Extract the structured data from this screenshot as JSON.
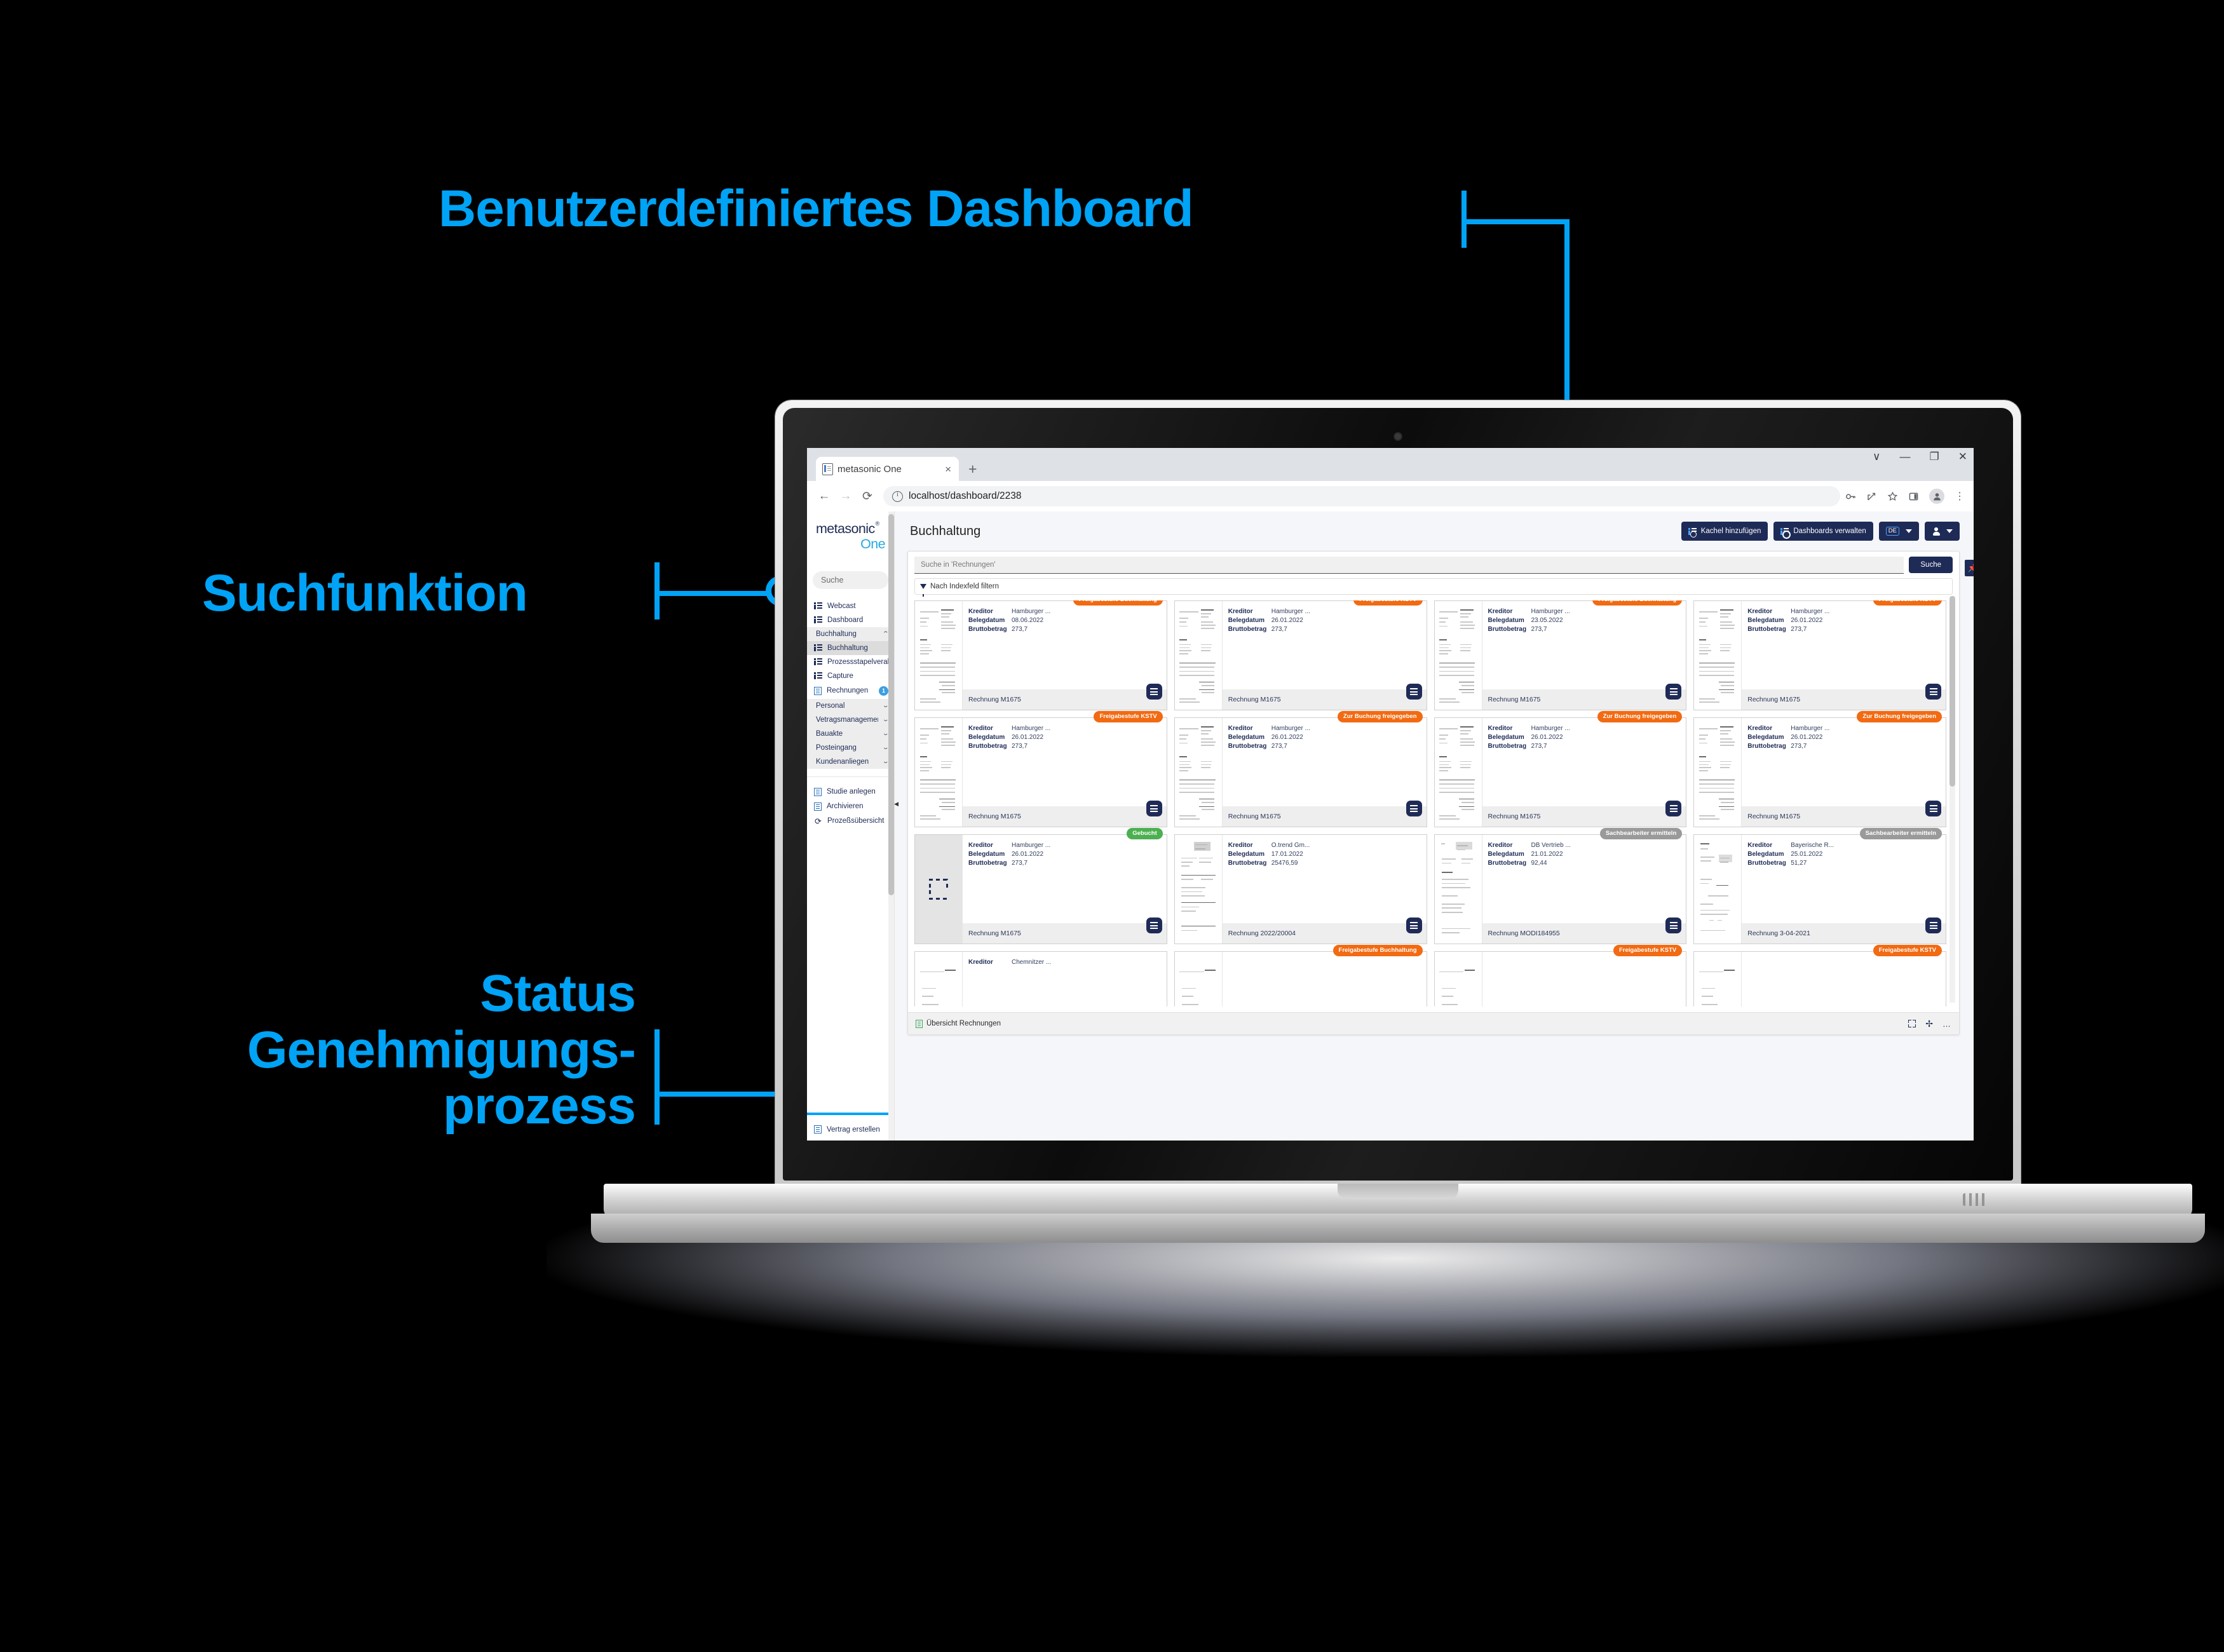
{
  "annotations": [
    {
      "id": "dashboard",
      "text": "Benutzerdefiniertes Dashboard"
    },
    {
      "id": "suche",
      "text": "Suchfunktion"
    },
    {
      "id": "status",
      "text": "Status Genehmigungs-prozess"
    }
  ],
  "accent_color": "#00A3F5",
  "browser": {
    "tab_title": "metasonic One",
    "tab_close": "×",
    "new_tab": "+",
    "back": "←",
    "forward": "→",
    "reload": "⟳",
    "url": "localhost/dashboard/2238",
    "window_controls": [
      "∨",
      "—",
      "❐",
      "✕"
    ],
    "actions": [
      "key-icon",
      "share-icon",
      "bookmark-star-icon",
      "sidepanel-icon",
      "profile-icon",
      "menu-kebab-icon"
    ],
    "kebab": "⋮"
  },
  "sidebar": {
    "logo_line1": "metasonic",
    "logo_reg": "®",
    "logo_line2": "One",
    "search_placeholder": "Suche",
    "items": [
      {
        "label": "Webcast",
        "icon": "list-icon",
        "type": "link"
      },
      {
        "label": "Dashboard",
        "icon": "list-icon",
        "type": "link"
      },
      {
        "label": "Buchhaltung",
        "icon": "none",
        "type": "group",
        "expanded": true,
        "chevron": "⌃"
      },
      {
        "label": "Buchhaltung",
        "icon": "list-icon",
        "type": "link",
        "active": true
      },
      {
        "label": "Prozessstapelverabeitung",
        "icon": "list-icon",
        "type": "link"
      },
      {
        "label": "Capture",
        "icon": "list-icon",
        "type": "link"
      },
      {
        "label": "Rechnungen",
        "icon": "invoice-icon",
        "type": "link",
        "badge": "1"
      },
      {
        "label": "Personal",
        "icon": "none",
        "type": "group",
        "chevron": "⌄"
      },
      {
        "label": "Vetragsmanagement",
        "icon": "none",
        "type": "group",
        "chevron": "⌄"
      },
      {
        "label": "Bauakte",
        "icon": "none",
        "type": "group",
        "chevron": "⌄"
      },
      {
        "label": "Posteingang",
        "icon": "none",
        "type": "group",
        "chevron": "⌄"
      },
      {
        "label": "Kundenanliegen",
        "icon": "none",
        "type": "group",
        "chevron": "⌄"
      }
    ],
    "actions": [
      {
        "label": "Studie anlegen",
        "icon": "doc-icon"
      },
      {
        "label": "Archivieren",
        "icon": "doc-icon"
      },
      {
        "label": "Prozeßsübersicht",
        "icon": "sync-icon"
      }
    ],
    "footer": [
      {
        "label": "Vertrag erstellen",
        "icon": "doc-icon"
      }
    ]
  },
  "header": {
    "title": "Buchhaltung",
    "buttons": [
      {
        "label": "Kachel hinzufügen",
        "icon": "tile-add-icon"
      },
      {
        "label": "Dashboards verwalten",
        "icon": "tile-settings-icon"
      }
    ],
    "language": "DE",
    "caret": "▾"
  },
  "panel": {
    "search_placeholder": "Suche in 'Rechnungen'",
    "search_button": "Suche",
    "filter_label": "Nach Indexfeld filtern",
    "footer_label": "Übersicht Rechnungen",
    "footer_icons": [
      "fullscreen-icon",
      "move-icon",
      "more-icon"
    ],
    "more": "…",
    "field_labels": {
      "kreditor": "Kreditor",
      "belegdatum": "Belegdatum",
      "bruttobetrag": "Bruttobetrag"
    },
    "pin_icon": "pin-icon"
  },
  "cards": [
    {
      "status": "Freigabestufe Buchhaltung",
      "status_color": "orange",
      "kreditor": "Hamburger ...",
      "belegdatum": "08.06.2022",
      "bruttobetrag": "273,7",
      "title": "Rechnung M1675",
      "preview": "invoice"
    },
    {
      "status": "Freigabestufe KSTV",
      "status_color": "orange",
      "kreditor": "Hamburger ...",
      "belegdatum": "26.01.2022",
      "bruttobetrag": "273,7",
      "title": "Rechnung M1675",
      "preview": "invoice"
    },
    {
      "status": "Freigabestufe Buchhaltung",
      "status_color": "orange",
      "kreditor": "Hamburger ...",
      "belegdatum": "23.05.2022",
      "bruttobetrag": "273,7",
      "title": "Rechnung M1675",
      "preview": "invoice"
    },
    {
      "status": "Freigabestufe KSTV",
      "status_color": "orange",
      "kreditor": "Hamburger ...",
      "belegdatum": "26.01.2022",
      "bruttobetrag": "273,7",
      "title": "Rechnung M1675",
      "preview": "invoice"
    },
    {
      "status": "Freigabestufe KSTV",
      "status_color": "orange",
      "kreditor": "Hamburger ...",
      "belegdatum": "26.01.2022",
      "bruttobetrag": "273,7",
      "title": "Rechnung M1675",
      "preview": "invoice"
    },
    {
      "status": "Zur Buchung freigegeben",
      "status_color": "orange",
      "kreditor": "Hamburger ...",
      "belegdatum": "26.01.2022",
      "bruttobetrag": "273,7",
      "title": "Rechnung M1675",
      "preview": "invoice"
    },
    {
      "status": "Zur Buchung freigegeben",
      "status_color": "orange",
      "kreditor": "Hamburger ...",
      "belegdatum": "26.01.2022",
      "bruttobetrag": "273,7",
      "title": "Rechnung M1675",
      "preview": "invoice"
    },
    {
      "status": "Zur Buchung freigegeben",
      "status_color": "orange",
      "kreditor": "Hamburger ...",
      "belegdatum": "26.01.2022",
      "bruttobetrag": "273,7",
      "title": "Rechnung M1675",
      "preview": "invoice"
    },
    {
      "status": "Gebucht",
      "status_color": "green",
      "kreditor": "Hamburger ...",
      "belegdatum": "26.01.2022",
      "bruttobetrag": "273,7",
      "title": "Rechnung M1675",
      "preview": "none"
    },
    {
      "status": "",
      "status_color": "none",
      "kreditor": "O.trend Gm...",
      "belegdatum": "17.01.2022",
      "bruttobetrag": "25476,59",
      "title": "Rechnung 2022/20004",
      "preview": "scan-a"
    },
    {
      "status": "Sachbearbeiter ermitteln",
      "status_color": "grey",
      "kreditor": "DB Vertrieb ...",
      "belegdatum": "21.01.2022",
      "bruttobetrag": "92,44",
      "title": "Rechnung MODI184955",
      "preview": "scan-b"
    },
    {
      "status": "Sachbearbeiter ermitteln",
      "status_color": "grey",
      "kreditor": "Bayerische R...",
      "belegdatum": "25.01.2022",
      "bruttobetrag": "51,27",
      "title": "Rechnung 3-04-2021",
      "preview": "scan-c"
    },
    {
      "status": "",
      "status_color": "none",
      "kreditor": "Chemnitzer ...",
      "belegdatum": "",
      "bruttobetrag": "",
      "title": "",
      "preview": "cvag"
    },
    {
      "status": "Freigabestufe Buchhaltung",
      "status_color": "orange",
      "kreditor": "",
      "belegdatum": "",
      "bruttobetrag": "",
      "title": "",
      "preview": "cvag"
    },
    {
      "status": "Freigabestufe KSTV",
      "status_color": "orange",
      "kreditor": "",
      "belegdatum": "",
      "bruttobetrag": "",
      "title": "",
      "preview": "cvag"
    },
    {
      "status": "Freigabestufe KSTV",
      "status_color": "orange",
      "kreditor": "",
      "belegdatum": "",
      "bruttobetrag": "",
      "title": "",
      "preview": "cvag"
    }
  ]
}
